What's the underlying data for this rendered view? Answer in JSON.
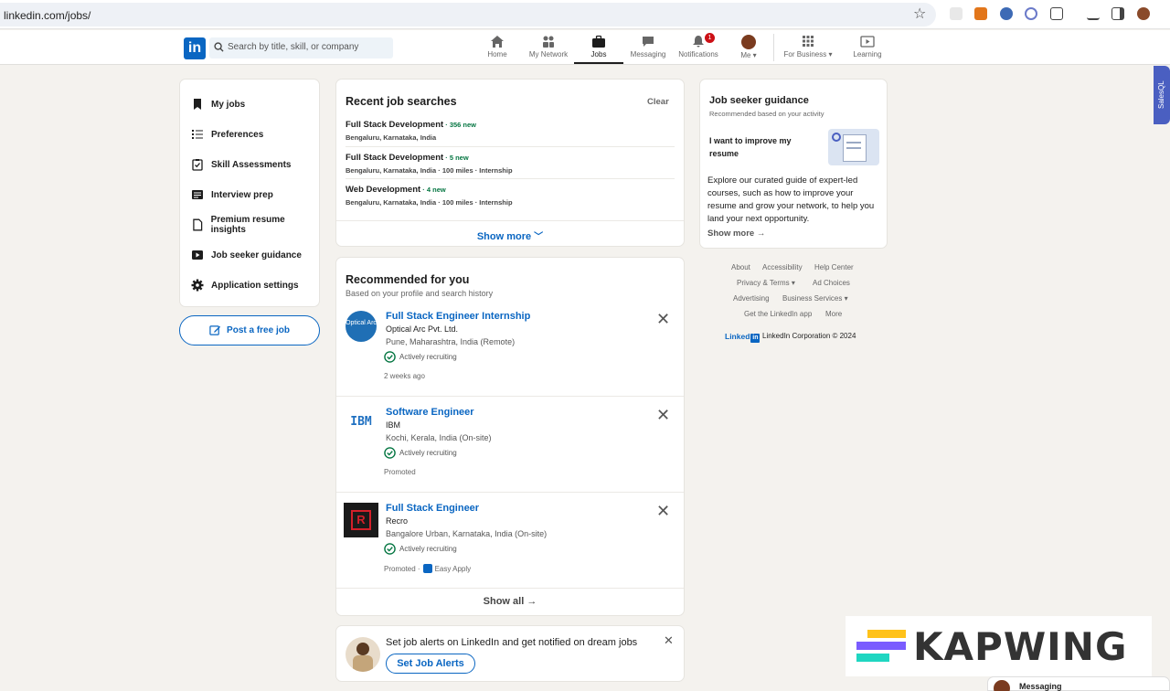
{
  "browser": {
    "url": "linkedin.com/jobs/"
  },
  "nav": {
    "logo": "in",
    "search_placeholder": "Search by title, skill, or company",
    "items": [
      {
        "label": "Home"
      },
      {
        "label": "My Network"
      },
      {
        "label": "Jobs"
      },
      {
        "label": "Messaging"
      },
      {
        "label": "Notifications"
      },
      {
        "label": "Me ▾"
      },
      {
        "label": "For Business ▾"
      },
      {
        "label": "Learning"
      }
    ],
    "notification_count": "1"
  },
  "sidebar": {
    "items": [
      {
        "label": "My jobs"
      },
      {
        "label": "Preferences"
      },
      {
        "label": "Skill Assessments"
      },
      {
        "label": "Interview prep"
      },
      {
        "label": "Premium resume insights"
      },
      {
        "label": "Job seeker guidance"
      },
      {
        "label": "Application settings"
      }
    ],
    "post_job": "Post a free job"
  },
  "recent_searches": {
    "title": "Recent job searches",
    "clear": "Clear",
    "items": [
      {
        "title": "Full Stack Development",
        "new": " · 356 new",
        "location": "Bengaluru, Karnataka, India"
      },
      {
        "title": "Full Stack Development",
        "new": " · 5 new",
        "location": "Bengaluru, Karnataka, India · 100 miles · Internship"
      },
      {
        "title": "Web Development",
        "new": " · 4 new",
        "location": "Bengaluru, Karnataka, India · 100 miles · Internship"
      }
    ],
    "show_more": "Show more"
  },
  "recommended": {
    "title": "Recommended for you",
    "subtitle": "Based on your profile and search history",
    "jobs": [
      {
        "title": "Full Stack Engineer Internship",
        "company": "Optical Arc Pvt. Ltd.",
        "location": "Pune, Maharashtra, India (Remote)",
        "status": "Actively recruiting",
        "meta": "2 weeks ago",
        "logo_text": "Optical Arc"
      },
      {
        "title": "Software Engineer",
        "company": "IBM",
        "location": "Kochi, Kerala, India (On-site)",
        "status": "Actively recruiting",
        "meta": "Promoted",
        "logo_text": "IBM"
      },
      {
        "title": "Full Stack Engineer",
        "company": "Recro",
        "location": "Bangalore Urban, Karnataka, India (On-site)",
        "status": "Actively recruiting",
        "meta": "Promoted ·",
        "easy_apply": "Easy Apply",
        "logo_text": "R"
      }
    ],
    "show_all": "Show all →"
  },
  "job_alerts": {
    "text": "Set job alerts on LinkedIn and get notified on dream jobs",
    "button": "Set Job Alerts"
  },
  "guidance": {
    "title": "Job seeker guidance",
    "subtitle": "Recommended based on your activity",
    "headline": "I want to improve my resume",
    "body": "Explore our curated guide of expert-led courses, such as how to improve your resume and grow your network, to help you land your next opportunity.",
    "show_more": "Show more →"
  },
  "footer": {
    "links": [
      "About",
      "Accessibility",
      "Help Center",
      "Privacy & Terms ▾",
      "Ad Choices",
      "Advertising",
      "Business Services ▾",
      "Get the LinkedIn app",
      "More"
    ],
    "brand": "Linked",
    "copyright": "LinkedIn Corporation © 2024"
  },
  "watermark": {
    "text": "KAPWING"
  },
  "messaging": {
    "label": "Messaging"
  },
  "salesql": {
    "label": "SalesQL"
  },
  "colors": {
    "brand": "#0a66c2",
    "new_badge": "#057642",
    "background": "#f4f2ee"
  }
}
